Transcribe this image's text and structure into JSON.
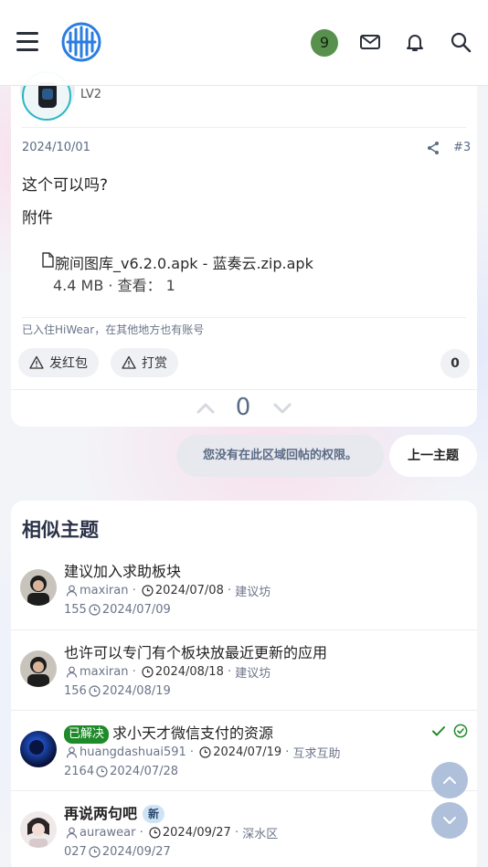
{
  "header": {
    "menu_icon": "hamburger-icon",
    "logo_icon": "site-logo",
    "notification_count": "9",
    "icons": [
      "mail-icon",
      "bell-icon",
      "search-icon"
    ]
  },
  "post": {
    "level": "LV2",
    "date": "2024/10/01",
    "post_number": "#3",
    "text": "这个可以吗?",
    "attachments_label": "附件",
    "attachment": {
      "file_name": "腕间图库_v6.2.0.apk - 蓝奏云.zip.apk",
      "meta": "4.4 MB · 查看：  1"
    },
    "signature": "已入住HiWear，在其他地方也有账号",
    "actions": {
      "red_packet": "发红包",
      "tip": "打赏",
      "count": "0"
    },
    "vote_count": "0"
  },
  "reply_bar": {
    "no_permission": "您没有在此区域回帖的权限。",
    "prev_thread": "上一主题"
  },
  "similar": {
    "title": "相似主题",
    "threads": [
      {
        "title": "建议加入求助板块",
        "author": "maxiran",
        "date": "2024/07/08",
        "forum": "建议坊",
        "replies": "1",
        "views": "55",
        "last_date": "2024/07/09"
      },
      {
        "title": "也许可以专门有个板块放最近更新的应用",
        "author": "maxiran",
        "date": "2024/08/18",
        "forum": "建议坊",
        "replies": "1",
        "views": "56",
        "last_date": "2024/08/19"
      },
      {
        "badge": "已解决",
        "title": "求小天才微信支付的资源",
        "author": "huangdashuai591",
        "date": "2024/07/19",
        "forum": "互求互助",
        "replies": "2",
        "views": "164",
        "last_date": "2024/07/28"
      },
      {
        "title": "再说两句吧",
        "new_badge": "新",
        "author": "aurawear",
        "date": "2024/09/27",
        "forum": "深水区",
        "replies": "0",
        "views": "27",
        "last_date": "2024/09/27"
      }
    ]
  },
  "colors": {
    "accent": "#5a6b86",
    "badge_green": "#58914d",
    "solved_green": "#1f8a2a",
    "logo_blue": "#2a7de1"
  }
}
